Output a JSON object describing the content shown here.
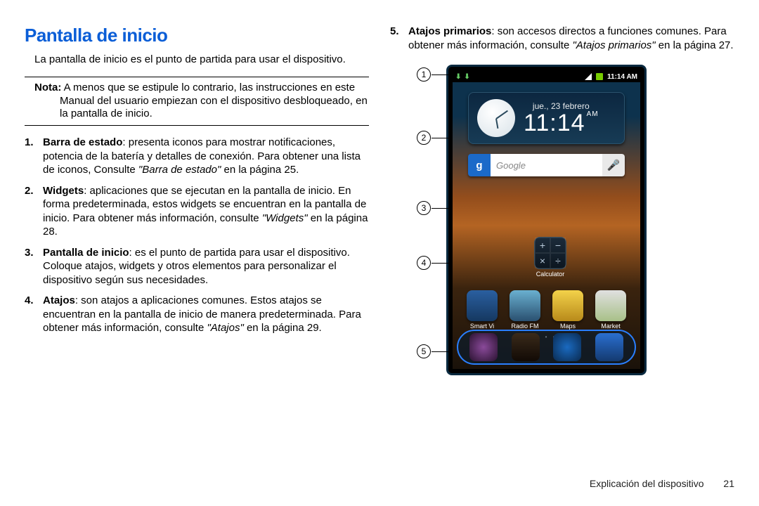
{
  "title": "Pantalla de inicio",
  "intro": "La pantalla de inicio es el punto de partida para usar el dispositivo.",
  "note": {
    "label": "Nota:",
    "text": " A menos que se estipule lo contrario, las instrucciones en este Manual del usuario empiezan con el dispositivo desbloqueado, en la pantalla de inicio."
  },
  "items_left": [
    {
      "num": "1.",
      "label": "Barra de estado",
      "text": ": presenta iconos para mostrar notificaciones, potencia de la batería y detalles de conexión. Para obtener una lista de iconos, Consulte ",
      "ref": "\"Barra de estado\"",
      "tail": " en la página 25."
    },
    {
      "num": "2.",
      "label": "Widgets",
      "text": ": aplicaciones que se ejecutan en la pantalla de inicio. En forma predeterminada, estos widgets se encuentran en la pantalla de inicio. Para obtener más información, consulte ",
      "ref": "\"Widgets\"",
      "tail": " en la página 28."
    },
    {
      "num": "3.",
      "label": "Pantalla de inicio",
      "text": ": es el punto de partida para usar el dispositivo. Coloque atajos, widgets y otros elementos para personalizar el dispositivo según sus necesidades.",
      "ref": "",
      "tail": ""
    },
    {
      "num": "4.",
      "label": "Atajos",
      "text": ": son atajos a aplicaciones comunes. Estos atajos se encuentran en la pantalla de inicio de manera predeterminada. Para obtener más información, consulte ",
      "ref": "\"Atajos\"",
      "tail": " en la página 29."
    }
  ],
  "item_right": {
    "num": "5.",
    "label": "Atajos primarios",
    "text": ": son accesos directos a funciones comunes. Para obtener más información, consulte ",
    "ref": "\"Atajos primarios\"",
    "tail": " en la página 27."
  },
  "phone": {
    "status_time": "11:14 AM",
    "clock_date": "jue., 23 febrero",
    "clock_time": "11:14",
    "clock_ampm": "AM",
    "search_placeholder": "Google",
    "calc_label": "Calculator",
    "shortcuts": [
      {
        "label": "Smart Vi",
        "bg": "linear-gradient(#2a5fa0,#153860)"
      },
      {
        "label": "Radio FM",
        "bg": "linear-gradient(#6ab0d0,#2a5070)"
      },
      {
        "label": "Maps",
        "bg": "linear-gradient(#f3d24a,#b88a1a)"
      },
      {
        "label": "Market",
        "bg": "linear-gradient(#e0e0e0,#a8c088)"
      }
    ],
    "dock_colors": [
      "radial-gradient(circle,#8a4a9a,#2a1230)",
      "linear-gradient(#3a2a1a,#120a05)",
      "radial-gradient(circle,#1a6ac0,#0a2a50)",
      "linear-gradient(#2a6fd0,#143a70)"
    ]
  },
  "callouts": [
    "1",
    "2",
    "3",
    "4",
    "5"
  ],
  "footer": {
    "section": "Explicación del dispositivo",
    "page": "21"
  }
}
